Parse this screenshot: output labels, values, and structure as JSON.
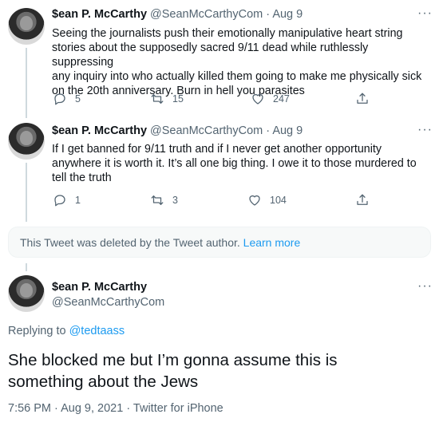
{
  "tweets": [
    {
      "name": "$ean P. McCarthy",
      "meta": "@SeanMcCarthyCom · Aug 9",
      "lines": [
        "Seeing the journalists push their emotionally manipulative heart string",
        "stories about the supposedly sacred 9/11 dead while ruthlessly suppressing",
        "any inquiry into who actually killed them going to make me physically sick",
        "on the 20th anniversary. Burn in hell you parasites"
      ],
      "replies": "5",
      "retweets": "15",
      "likes": "247"
    },
    {
      "name": "$ean P. McCarthy",
      "meta": "@SeanMcCarthyCom · Aug 9",
      "lines": [
        "If I get banned for 9/11 truth and if I never get another opportunity",
        "anywhere it is worth it. It’s all one big thing. I owe it to those murdered to",
        "tell the truth"
      ],
      "replies": "1",
      "retweets": "3",
      "likes": "104"
    }
  ],
  "deleted": {
    "text": "This Tweet was deleted by the Tweet author.",
    "link": "Learn more"
  },
  "main_tweet": {
    "name": "$ean P. McCarthy",
    "handle": "@SeanMcCarthyCom",
    "replying_prefix": "Replying to",
    "replying_handle": "@tedtaass",
    "lines": [
      "She blocked me but I’m gonna assume this is",
      "something about the Jews"
    ],
    "timestamp": "7:56 PM · Aug 9, 2021 · Twitter for iPhone"
  },
  "colors": {
    "link": "#1d9bf0",
    "secondary_text": "#536471",
    "thread_line": "#cfd9de"
  },
  "icons": {
    "more": "more-icon",
    "reply": "reply-icon",
    "retweet": "retweet-icon",
    "like": "like-icon",
    "share": "share-icon"
  }
}
